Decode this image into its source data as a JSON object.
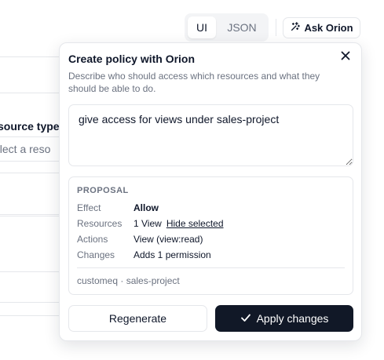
{
  "toolbar": {
    "view_tabs": [
      "UI",
      "JSON"
    ],
    "ask_button_label": "Ask Orion"
  },
  "background": {
    "field_label": "source type",
    "select_placeholder": "elect a reso"
  },
  "popover": {
    "title": "Create policy with Orion",
    "description": "Describe who should access which resources and what they should be able to do.",
    "prompt_value": "give access for views under sales-project",
    "proposal": {
      "heading": "PROPOSAL",
      "rows": [
        {
          "key": "Effect",
          "value": "Allow"
        },
        {
          "key": "Resources",
          "value": "1 View",
          "link": "Hide selected"
        },
        {
          "key": "Actions",
          "value": "View (view:read)"
        },
        {
          "key": "Changes",
          "value": "Adds 1 permission"
        }
      ],
      "footer": "customeq · sales-project"
    },
    "regenerate_label": "Regenerate",
    "apply_label": "Apply changes"
  },
  "colors": {
    "accent_dark": "#111827",
    "border": "#e5e7eb",
    "muted_text": "#6b7280"
  }
}
